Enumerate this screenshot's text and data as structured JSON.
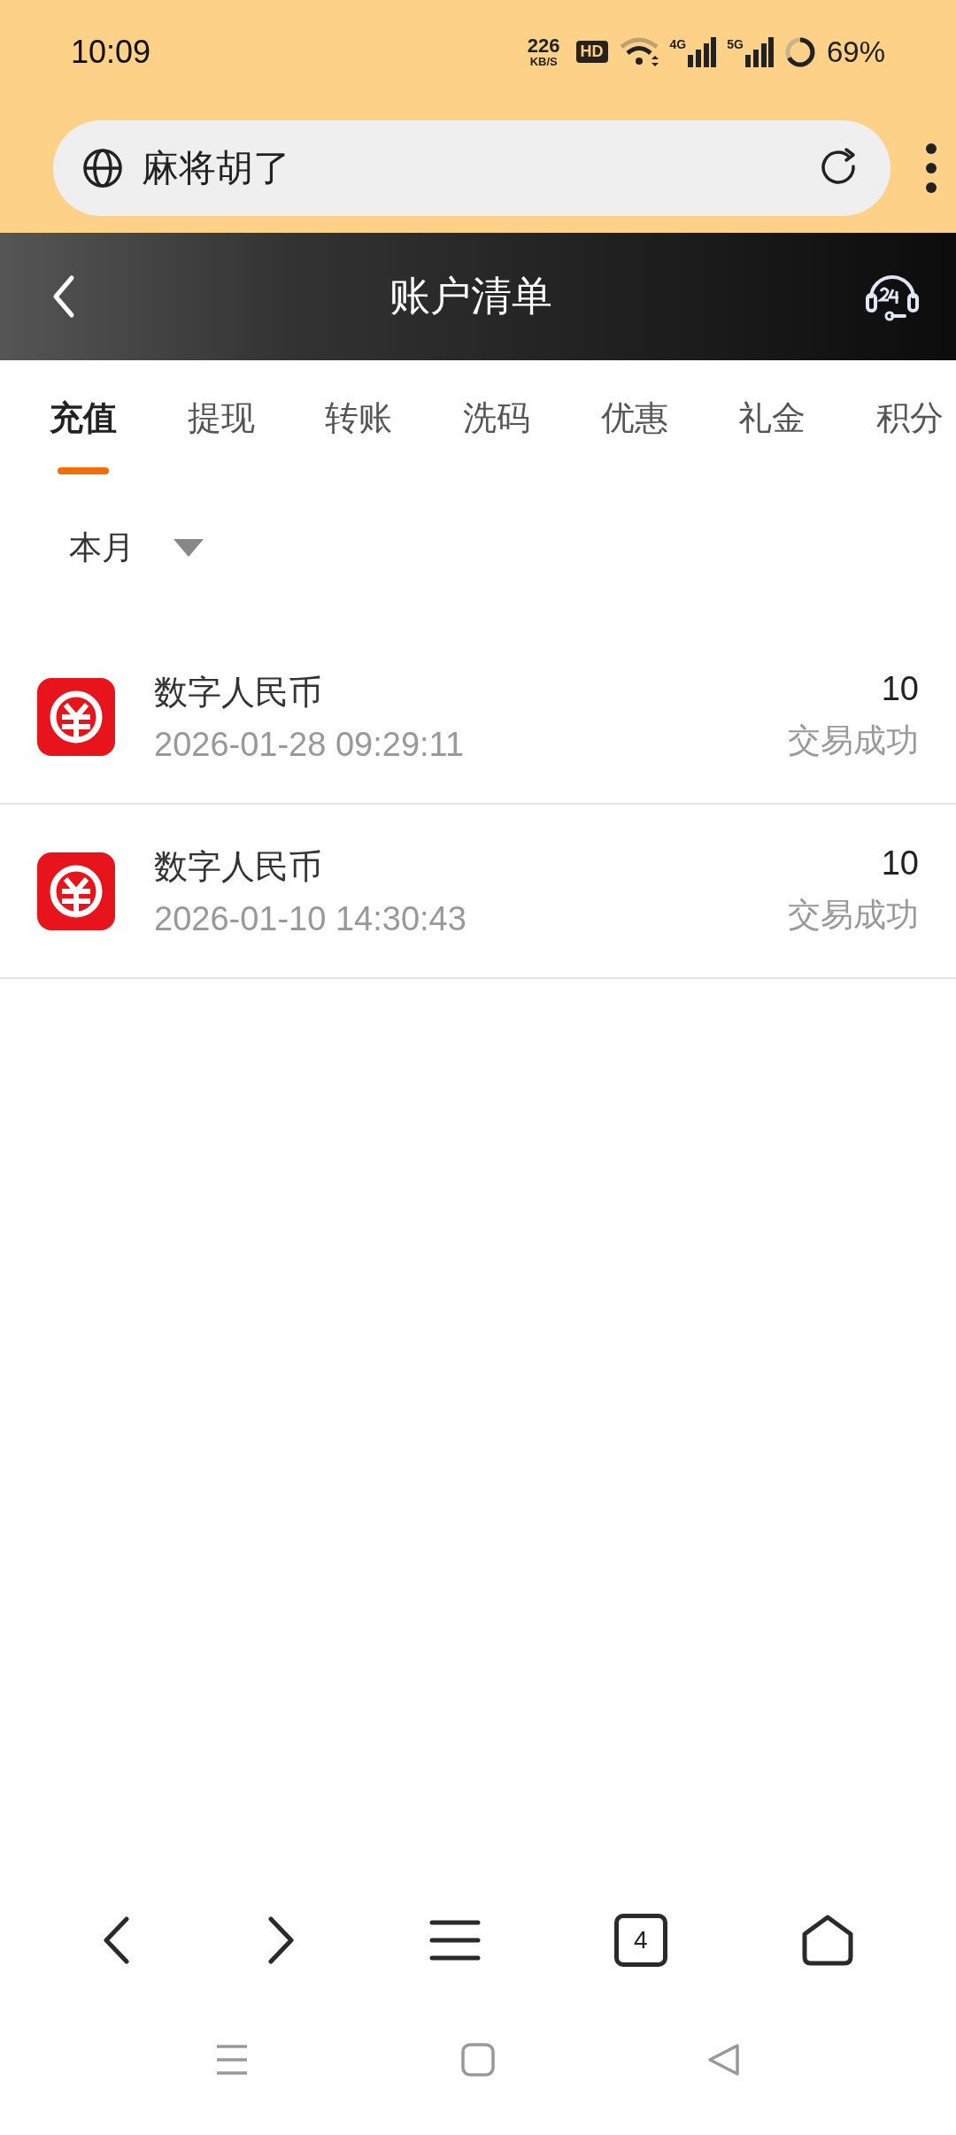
{
  "status_bar": {
    "time": "10:09",
    "speed": "226",
    "speed_unit": "KB/S",
    "hd": "HD",
    "networks": [
      "4G",
      "5G"
    ],
    "battery": "69%"
  },
  "address_bar": {
    "title": "麻将胡了"
  },
  "header": {
    "title": "账户清单"
  },
  "tabs": [
    {
      "label": "充值",
      "selected": true
    },
    {
      "label": "提现",
      "selected": false
    },
    {
      "label": "转账",
      "selected": false
    },
    {
      "label": "洗码",
      "selected": false
    },
    {
      "label": "优惠",
      "selected": false
    },
    {
      "label": "礼金",
      "selected": false
    },
    {
      "label": "积分",
      "selected": false
    }
  ],
  "filter": {
    "label": "本月"
  },
  "transactions": [
    {
      "name": "数字人民币",
      "time": "2026-01-28 09:29:11",
      "amount": "10",
      "status": "交易成功"
    },
    {
      "name": "数字人民币",
      "time": "2026-01-10 14:30:43",
      "amount": "10",
      "status": "交易成功"
    }
  ],
  "browser_nav": {
    "tab_count": "4"
  }
}
